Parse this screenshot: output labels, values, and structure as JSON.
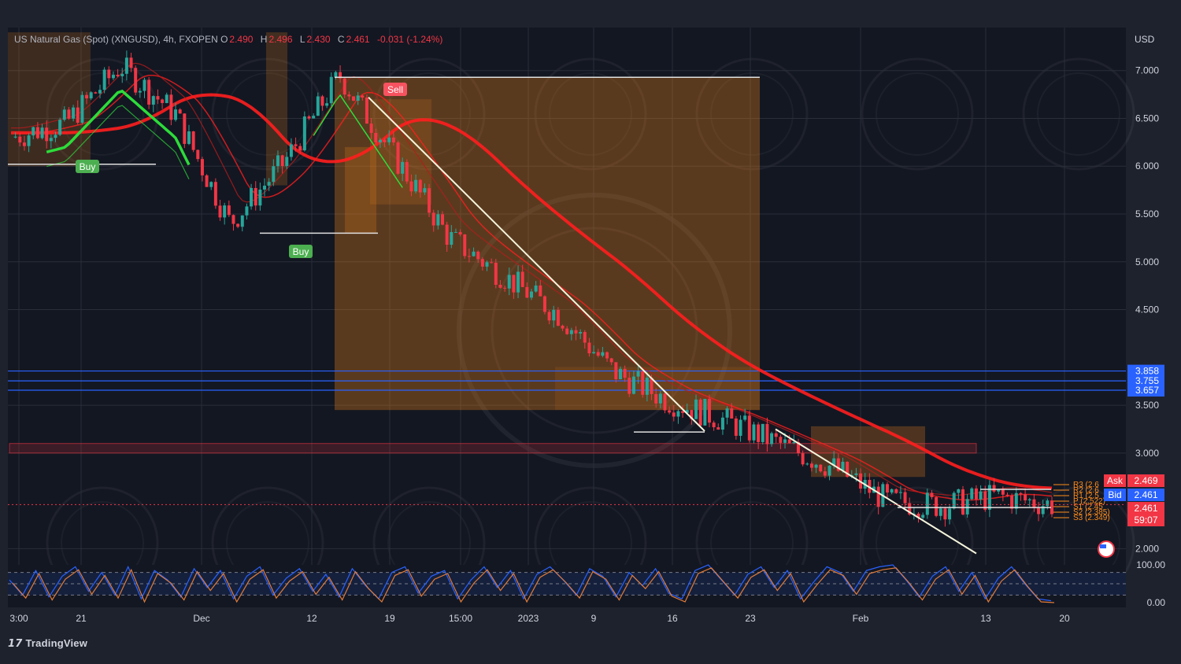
{
  "legend": {
    "symbol": "US Natural Gas (Spot) (XNGUSD), 4h, FXOPEN",
    "open_label": "O",
    "open": "2.490",
    "high_label": "H",
    "high": "2.496",
    "low_label": "L",
    "low": "2.430",
    "close_label": "C",
    "close": "2.461",
    "change": "-0.031 (-1.24%)"
  },
  "currency": "USD",
  "brand": "TradingView",
  "colors": {
    "background": "#131722",
    "frame": "#1e222d",
    "bull": "#26a69a",
    "bear": "#f23645",
    "ema_red": "#ff1e1e",
    "ema_green": "#2ddc3a",
    "support_blue": "#2962ff",
    "zone_orange": "#ff8c1a",
    "zone_pink": "#f23645",
    "buy_signal": "#4caf50",
    "sell_signal": "#f7525f",
    "oscillator": "#e07b39"
  },
  "chart_data": [
    {
      "type": "line",
      "title": "US Natural Gas (Spot) (XNGUSD), 4h, FXOPEN",
      "x": [
        "21",
        "Dec",
        "12",
        "19",
        "15:00",
        "2023",
        "9",
        "16",
        "23",
        "Feb",
        "13",
        "20"
      ],
      "x_ticks": [
        "3:00",
        "21",
        "Dec",
        "12",
        "19",
        "15:00",
        "2023",
        "9",
        "16",
        "23",
        "Feb",
        "13",
        "20"
      ],
      "ylabel": "USD",
      "y_ticks": [
        "2.000",
        "3.000",
        "3.500",
        "4.500",
        "5.000",
        "5.500",
        "6.000",
        "6.500",
        "7.000"
      ],
      "ylim": [
        1.88,
        7.45
      ],
      "series": [
        {
          "values": [
            6.3,
            6.45,
            7.05,
            6.55,
            5.4,
            6.05,
            6.95,
            6.1,
            5.25,
            4.85,
            4.45,
            3.85,
            3.55,
            3.35,
            3.1,
            2.85,
            2.5,
            2.45,
            2.55,
            2.46
          ]
        }
      ],
      "price_lines": [
        {
          "value": "3.858",
          "color": "#2962ff"
        },
        {
          "value": "3.755",
          "color": "#2962ff"
        },
        {
          "value": "3.657",
          "color": "#2962ff"
        }
      ],
      "zones": [
        {
          "kind": "resistance",
          "from": 3.0,
          "to": 3.1,
          "color": "#f23645"
        }
      ],
      "signals": [
        {
          "label": "Buy",
          "price": 6.0
        },
        {
          "label": "Buy",
          "price": 5.3
        },
        {
          "label": "Sell",
          "price": 6.8
        }
      ],
      "pivot_labels": [
        "R3 (2.6",
        "R2 (2.6",
        "R1 (2.5",
        "P (2.522)",
        "S1 (2.45",
        "S2 (2.385)",
        "S3 (2.349)"
      ],
      "price_tags": {
        "ask_label": "Ask",
        "ask": "2.469",
        "bid_label": "Bid",
        "bid": "2.461",
        "last": "2.461",
        "countdown": "59:07"
      },
      "grid": true
    },
    {
      "type": "line",
      "title": "",
      "y_ticks": [
        "100.00",
        "0.00"
      ],
      "ylim": [
        0,
        100
      ],
      "levels": [
        80,
        50,
        20
      ],
      "series": [
        {
          "values": [
            60,
            20,
            85,
            15,
            70,
            95,
            30,
            80,
            20,
            95,
            10,
            85,
            60,
            15,
            90,
            40,
            85,
            10,
            70,
            95,
            20,
            65,
            90,
            30,
            75,
            15,
            90,
            45,
            10,
            80,
            95,
            25,
            70,
            85,
            10,
            60,
            95,
            40,
            85,
            10,
            75,
            95,
            60,
            20,
            90,
            70,
            15,
            80,
            45,
            90,
            25,
            10,
            85,
            100,
            60,
            20,
            75,
            95,
            40,
            85,
            10,
            55,
            95,
            80,
            30,
            85,
            95,
            100,
            60,
            15,
            70,
            95,
            30,
            80,
            10,
            65,
            95,
            50,
            10,
            5
          ]
        }
      ]
    }
  ]
}
